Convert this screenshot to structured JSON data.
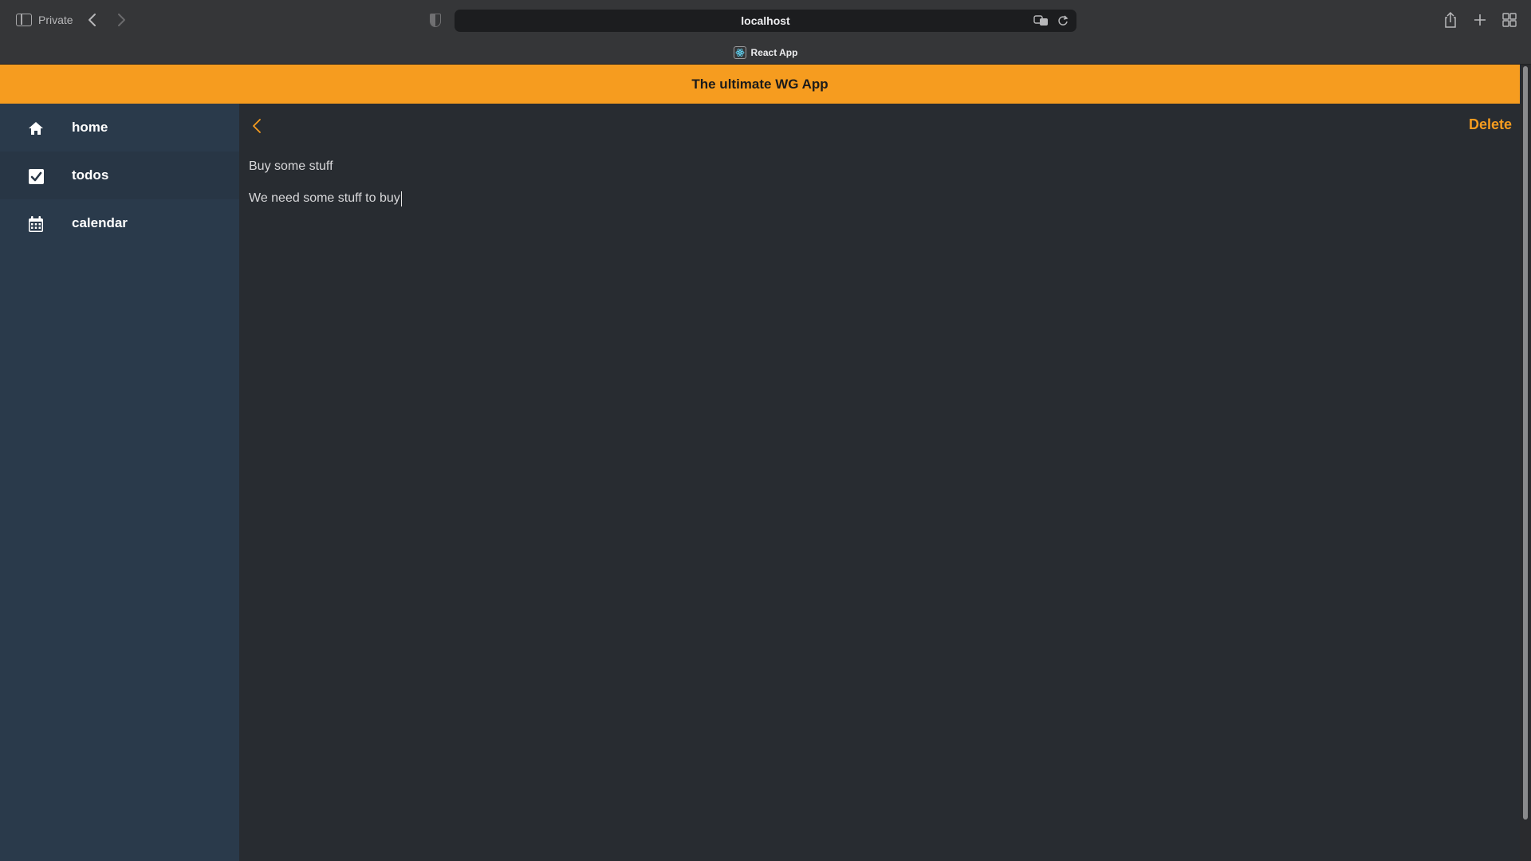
{
  "browser": {
    "private_label": "Private",
    "url": "localhost",
    "tab_title": "React App",
    "icons": [
      "sidebar-toggle-icon",
      "back-arrow-icon",
      "forward-arrow-icon",
      "shield-icon",
      "translate-icon",
      "reload-icon",
      "share-icon",
      "new-tab-icon",
      "tab-overview-icon",
      "react-favicon"
    ]
  },
  "app": {
    "title": "The ultimate WG App",
    "accent_color": "#f69c1f"
  },
  "sidebar": {
    "items": [
      {
        "label": "home",
        "icon": "home-icon",
        "active": false
      },
      {
        "label": "todos",
        "icon": "checkbox-icon",
        "active": true
      },
      {
        "label": "calendar",
        "icon": "calendar-icon",
        "active": false
      }
    ]
  },
  "detail": {
    "back_icon": "chevron-left-icon",
    "delete_label": "Delete",
    "title_value": "Buy some stuff",
    "description_value": "We need some stuff to buy"
  }
}
